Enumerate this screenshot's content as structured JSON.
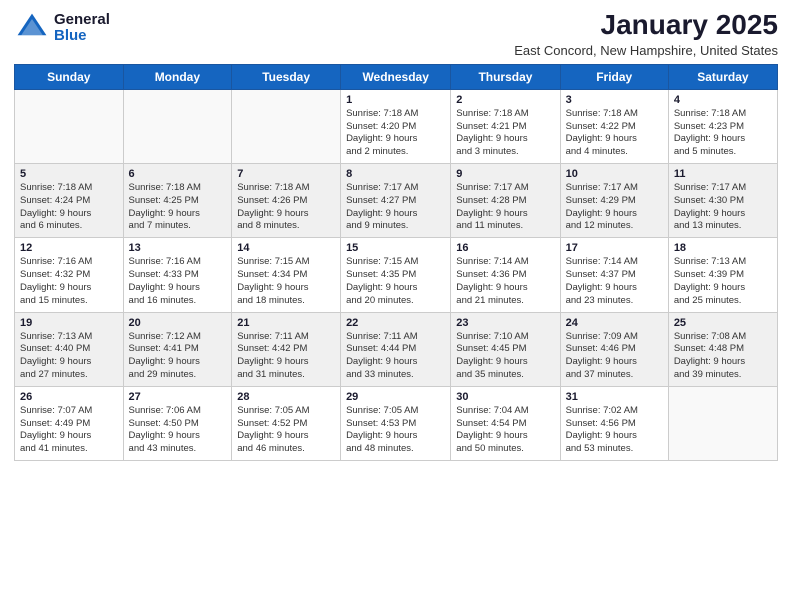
{
  "header": {
    "logo_general": "General",
    "logo_blue": "Blue",
    "main_title": "January 2025",
    "subtitle": "East Concord, New Hampshire, United States"
  },
  "days_of_week": [
    "Sunday",
    "Monday",
    "Tuesday",
    "Wednesday",
    "Thursday",
    "Friday",
    "Saturday"
  ],
  "weeks": [
    {
      "cells": [
        {
          "day": null,
          "info": null
        },
        {
          "day": null,
          "info": null
        },
        {
          "day": null,
          "info": null
        },
        {
          "day": "1",
          "info": "Sunrise: 7:18 AM\nSunset: 4:20 PM\nDaylight: 9 hours\nand 2 minutes."
        },
        {
          "day": "2",
          "info": "Sunrise: 7:18 AM\nSunset: 4:21 PM\nDaylight: 9 hours\nand 3 minutes."
        },
        {
          "day": "3",
          "info": "Sunrise: 7:18 AM\nSunset: 4:22 PM\nDaylight: 9 hours\nand 4 minutes."
        },
        {
          "day": "4",
          "info": "Sunrise: 7:18 AM\nSunset: 4:23 PM\nDaylight: 9 hours\nand 5 minutes."
        }
      ]
    },
    {
      "cells": [
        {
          "day": "5",
          "info": "Sunrise: 7:18 AM\nSunset: 4:24 PM\nDaylight: 9 hours\nand 6 minutes."
        },
        {
          "day": "6",
          "info": "Sunrise: 7:18 AM\nSunset: 4:25 PM\nDaylight: 9 hours\nand 7 minutes."
        },
        {
          "day": "7",
          "info": "Sunrise: 7:18 AM\nSunset: 4:26 PM\nDaylight: 9 hours\nand 8 minutes."
        },
        {
          "day": "8",
          "info": "Sunrise: 7:17 AM\nSunset: 4:27 PM\nDaylight: 9 hours\nand 9 minutes."
        },
        {
          "day": "9",
          "info": "Sunrise: 7:17 AM\nSunset: 4:28 PM\nDaylight: 9 hours\nand 11 minutes."
        },
        {
          "day": "10",
          "info": "Sunrise: 7:17 AM\nSunset: 4:29 PM\nDaylight: 9 hours\nand 12 minutes."
        },
        {
          "day": "11",
          "info": "Sunrise: 7:17 AM\nSunset: 4:30 PM\nDaylight: 9 hours\nand 13 minutes."
        }
      ]
    },
    {
      "cells": [
        {
          "day": "12",
          "info": "Sunrise: 7:16 AM\nSunset: 4:32 PM\nDaylight: 9 hours\nand 15 minutes."
        },
        {
          "day": "13",
          "info": "Sunrise: 7:16 AM\nSunset: 4:33 PM\nDaylight: 9 hours\nand 16 minutes."
        },
        {
          "day": "14",
          "info": "Sunrise: 7:15 AM\nSunset: 4:34 PM\nDaylight: 9 hours\nand 18 minutes."
        },
        {
          "day": "15",
          "info": "Sunrise: 7:15 AM\nSunset: 4:35 PM\nDaylight: 9 hours\nand 20 minutes."
        },
        {
          "day": "16",
          "info": "Sunrise: 7:14 AM\nSunset: 4:36 PM\nDaylight: 9 hours\nand 21 minutes."
        },
        {
          "day": "17",
          "info": "Sunrise: 7:14 AM\nSunset: 4:37 PM\nDaylight: 9 hours\nand 23 minutes."
        },
        {
          "day": "18",
          "info": "Sunrise: 7:13 AM\nSunset: 4:39 PM\nDaylight: 9 hours\nand 25 minutes."
        }
      ]
    },
    {
      "cells": [
        {
          "day": "19",
          "info": "Sunrise: 7:13 AM\nSunset: 4:40 PM\nDaylight: 9 hours\nand 27 minutes."
        },
        {
          "day": "20",
          "info": "Sunrise: 7:12 AM\nSunset: 4:41 PM\nDaylight: 9 hours\nand 29 minutes."
        },
        {
          "day": "21",
          "info": "Sunrise: 7:11 AM\nSunset: 4:42 PM\nDaylight: 9 hours\nand 31 minutes."
        },
        {
          "day": "22",
          "info": "Sunrise: 7:11 AM\nSunset: 4:44 PM\nDaylight: 9 hours\nand 33 minutes."
        },
        {
          "day": "23",
          "info": "Sunrise: 7:10 AM\nSunset: 4:45 PM\nDaylight: 9 hours\nand 35 minutes."
        },
        {
          "day": "24",
          "info": "Sunrise: 7:09 AM\nSunset: 4:46 PM\nDaylight: 9 hours\nand 37 minutes."
        },
        {
          "day": "25",
          "info": "Sunrise: 7:08 AM\nSunset: 4:48 PM\nDaylight: 9 hours\nand 39 minutes."
        }
      ]
    },
    {
      "cells": [
        {
          "day": "26",
          "info": "Sunrise: 7:07 AM\nSunset: 4:49 PM\nDaylight: 9 hours\nand 41 minutes."
        },
        {
          "day": "27",
          "info": "Sunrise: 7:06 AM\nSunset: 4:50 PM\nDaylight: 9 hours\nand 43 minutes."
        },
        {
          "day": "28",
          "info": "Sunrise: 7:05 AM\nSunset: 4:52 PM\nDaylight: 9 hours\nand 46 minutes."
        },
        {
          "day": "29",
          "info": "Sunrise: 7:05 AM\nSunset: 4:53 PM\nDaylight: 9 hours\nand 48 minutes."
        },
        {
          "day": "30",
          "info": "Sunrise: 7:04 AM\nSunset: 4:54 PM\nDaylight: 9 hours\nand 50 minutes."
        },
        {
          "day": "31",
          "info": "Sunrise: 7:02 AM\nSunset: 4:56 PM\nDaylight: 9 hours\nand 53 minutes."
        },
        {
          "day": null,
          "info": null
        }
      ]
    }
  ]
}
